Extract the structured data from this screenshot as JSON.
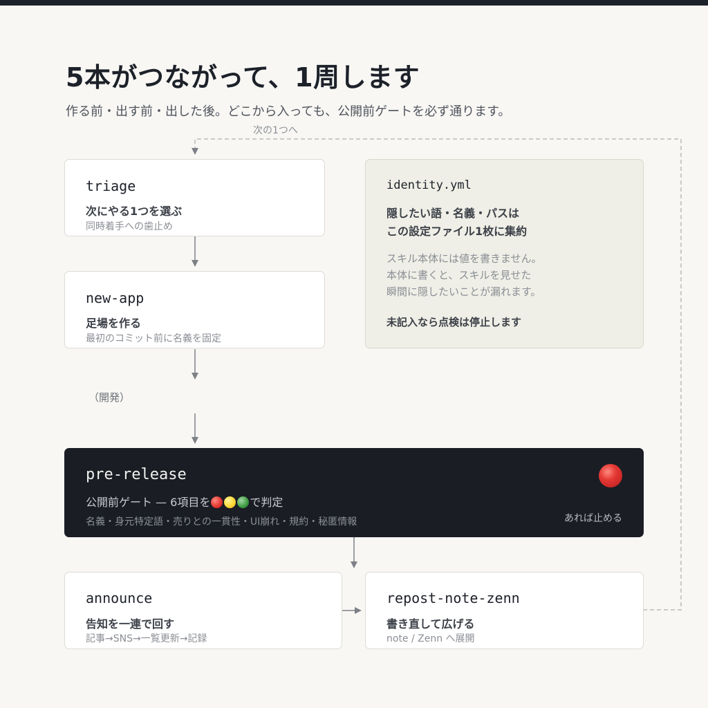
{
  "title": "5本がつながって、1周します",
  "subtitle": "作る前・出す前・出した後。どこから入っても、公開前ゲートを必ず通ります。",
  "loop_label": "次の1つへ",
  "dev_label": "（開発）",
  "colors": {
    "background": "#f8f7f4",
    "dark_card": "#1a1d24",
    "identity_card": "#efefe7",
    "red": "#e53935",
    "yellow": "#fdd835",
    "green": "#43a047"
  },
  "nodes": {
    "triage": {
      "name": "triage",
      "desc": "次にやる1つを選ぶ",
      "note": "同時着手への歯止め"
    },
    "new_app": {
      "name": "new-app",
      "desc": "足場を作る",
      "note": "最初のコミット前に名義を固定"
    },
    "identity": {
      "name": "identity.yml",
      "line1": "隠したい語・名義・パスは",
      "line2": "この設定ファイル1枚に集約",
      "gray1": "スキル本体には値を書きません。",
      "gray2": "本体に書くと、スキルを見せた",
      "gray3": "瞬間に隠したいことが漏れます。",
      "footer": "未記入なら点検は停止します"
    },
    "pre_release": {
      "name": "pre-release",
      "desc_prefix": "公開前ゲート — 6項目を",
      "desc_suffix": "で判定",
      "note": "名義・身元特定語・売りとの一貫性・UI崩れ・規約・秘匿情報",
      "stop": "あれば止める",
      "status_icon": "red-circle-icon",
      "signal_icons": [
        "red-dot-icon",
        "yellow-dot-icon",
        "green-dot-icon"
      ]
    },
    "announce": {
      "name": "announce",
      "desc": "告知を一連で回す",
      "note": "記事→SNS→一覧更新→記録"
    },
    "repost": {
      "name": "repost-note-zenn",
      "desc": "書き直して広げる",
      "note": "note / Zenn へ展開"
    }
  }
}
